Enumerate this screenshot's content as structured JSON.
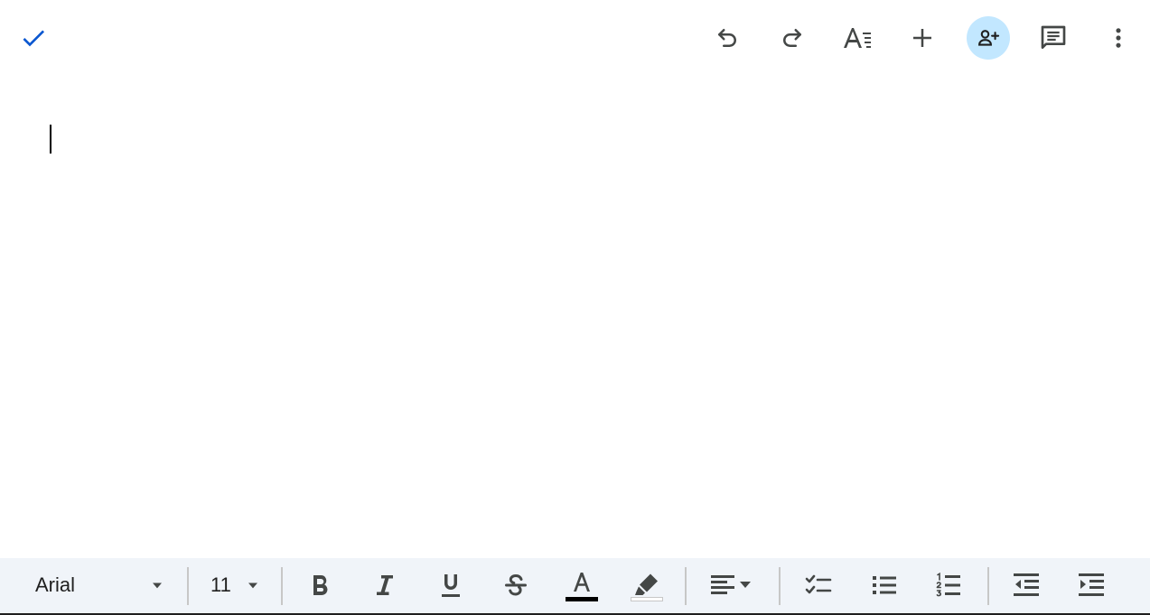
{
  "toolbar": {
    "done_icon": "check-icon",
    "undo_icon": "undo-icon",
    "redo_icon": "redo-icon",
    "text_format_icon": "text-format-icon",
    "insert_icon": "add-icon",
    "share_icon": "person-add-icon",
    "comment_icon": "comment-icon",
    "more_icon": "more-vert-icon"
  },
  "format_bar": {
    "font_family": "Arial",
    "font_size": "11",
    "buttons": [
      "bold",
      "italic",
      "underline",
      "strikethrough",
      "text-color",
      "highlight-color",
      "align",
      "checklist",
      "bulleted-list",
      "numbered-list",
      "decrease-indent",
      "increase-indent"
    ]
  },
  "colors": {
    "accent": "#0b57d0",
    "share_bg": "#c2e7ff",
    "format_bar_bg": "#f0f4f9",
    "icon": "#444746",
    "text_color_swatch": "#000000"
  }
}
